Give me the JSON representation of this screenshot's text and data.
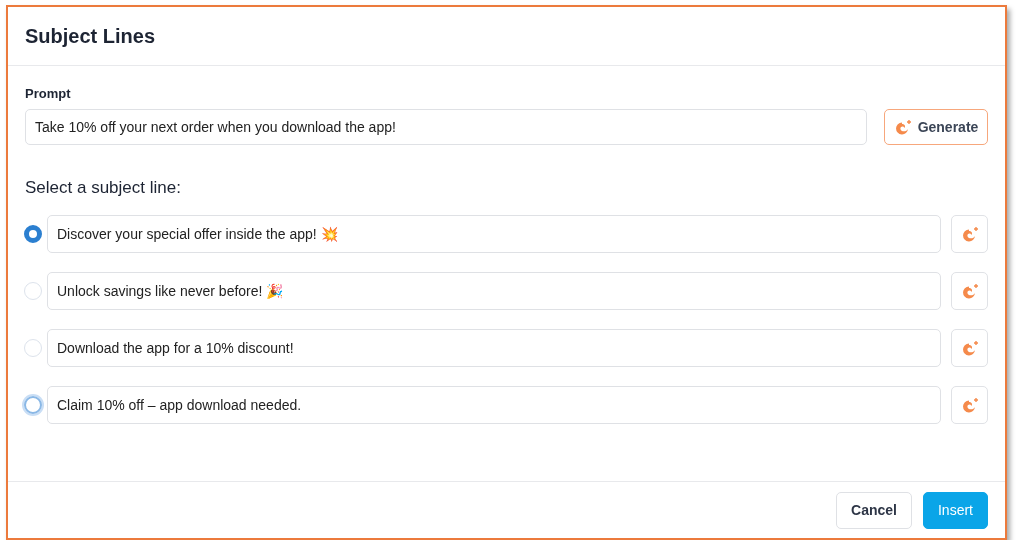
{
  "dialog": {
    "title": "Subject Lines"
  },
  "prompt": {
    "label": "Prompt",
    "value": "Take 10% off your next order when you download the app!",
    "generate_button": "Generate"
  },
  "options": {
    "heading": "Select a subject line:",
    "items": [
      {
        "text": "Discover your special offer inside the app! 💥",
        "selected": true,
        "focused": false
      },
      {
        "text": "Unlock savings like never before! 🎉",
        "selected": false,
        "focused": false
      },
      {
        "text": "Download the app for a 10% discount!",
        "selected": false,
        "focused": false
      },
      {
        "text": "Claim 10% off – app download needed.",
        "selected": false,
        "focused": true
      }
    ]
  },
  "buttons": [
    {
      "label": "Cancel",
      "kind": "secondary"
    },
    {
      "label": "Insert",
      "kind": "primary"
    }
  ]
}
